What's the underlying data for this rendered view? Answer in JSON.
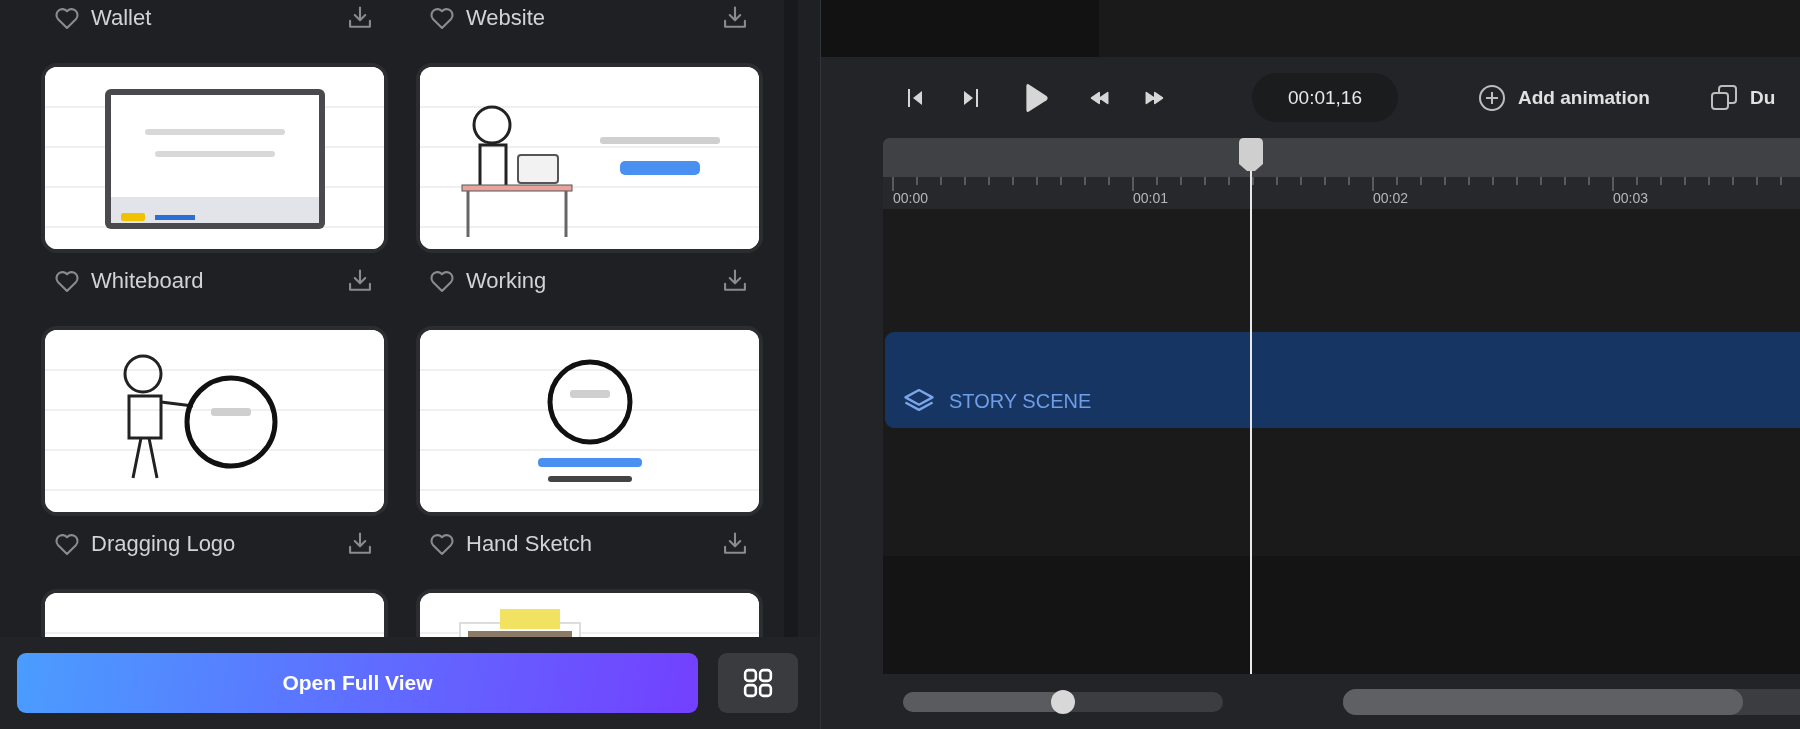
{
  "templates": [
    {
      "name": "Wallet"
    },
    {
      "name": "Website"
    },
    {
      "thumbnail": {
        "kind": "picture"
      },
      "name": "Whiteboard"
    },
    {
      "thumbnail": {
        "kind": "picture"
      },
      "name": "Working"
    },
    {
      "thumbnail": {
        "kind": "picture"
      },
      "name": "Dragging Logo"
    },
    {
      "thumbnail": {
        "kind": "picture"
      },
      "name": "Hand Sketch"
    },
    {
      "thumbnail": {
        "kind": "picture"
      }
    },
    {
      "thumbnail": {
        "kind": "picture"
      }
    }
  ],
  "open_button": {
    "label": "Open Full View"
  },
  "transport": [
    {
      "kind": "skip_start"
    },
    {
      "kind": "skip_end"
    },
    {
      "kind": "play"
    },
    {
      "kind": "rewind"
    },
    {
      "kind": "forward"
    }
  ],
  "time": "00:01,16",
  "actions": [
    {
      "kind": "add",
      "label": "Add animation"
    },
    {
      "kind": "duplicate",
      "label": "Du"
    }
  ],
  "ruler": [
    "00:00",
    "00:01",
    "00:02",
    "00:03"
  ],
  "clip": {
    "label": "STORY SCENE"
  },
  "zoom_slider": {
    "level": 0.5
  }
}
